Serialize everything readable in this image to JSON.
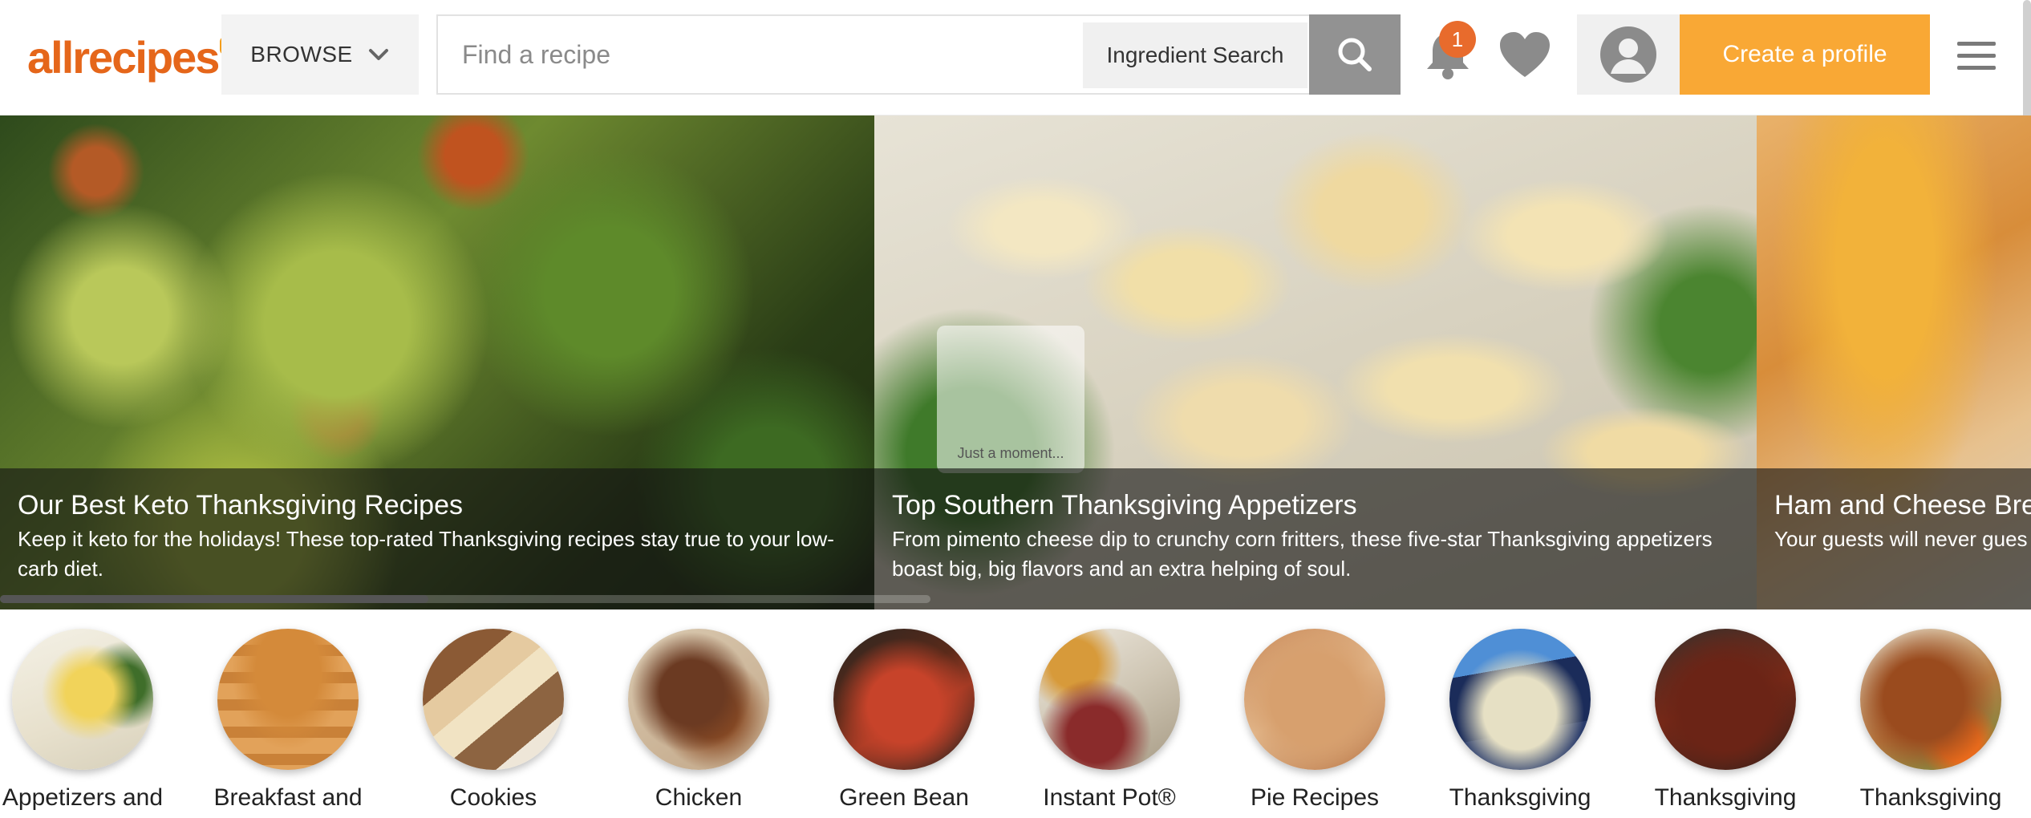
{
  "header": {
    "logo_text": "allrecipes",
    "browse_label": "BROWSE",
    "search": {
      "placeholder": "Find a recipe",
      "value": ""
    },
    "ingredient_search_label": "Ingredient Search",
    "notifications_count": "1",
    "create_profile_label": "Create a profile"
  },
  "carousel": {
    "slides": [
      {
        "title": "Our Best Keto Thanksgiving Recipes",
        "description": "Keep it keto for the holidays! These top-rated Thanksgiving recipes stay true to your low-carb diet."
      },
      {
        "title": "Top Southern Thanksgiving Appetizers",
        "description": "From pimento cheese dip to crunchy corn fritters, these five-star Thanksgiving appetizers boast big, big flavors and an extra helping of soul.",
        "loading_text": "Just a moment..."
      },
      {
        "title": "Ham and Cheese Bre",
        "description": "Your guests will never gues"
      }
    ],
    "progress": 0.46
  },
  "categories": [
    {
      "label": "Appetizers and"
    },
    {
      "label": "Breakfast and"
    },
    {
      "label": "Cookies"
    },
    {
      "label": "Chicken"
    },
    {
      "label": "Green Bean"
    },
    {
      "label": "Instant Pot®"
    },
    {
      "label": "Pie Recipes"
    },
    {
      "label": "Thanksgiving"
    },
    {
      "label": "Thanksgiving"
    },
    {
      "label": "Thanksgiving"
    }
  ],
  "colors": {
    "brand_orange": "#e5661a",
    "cta_orange": "#f9a835",
    "badge": "#e86b2c",
    "search_button": "#929292"
  },
  "icons": [
    "chevron-down-icon",
    "search-icon",
    "bell-icon",
    "heart-icon",
    "user-icon",
    "hamburger-menu-icon"
  ]
}
